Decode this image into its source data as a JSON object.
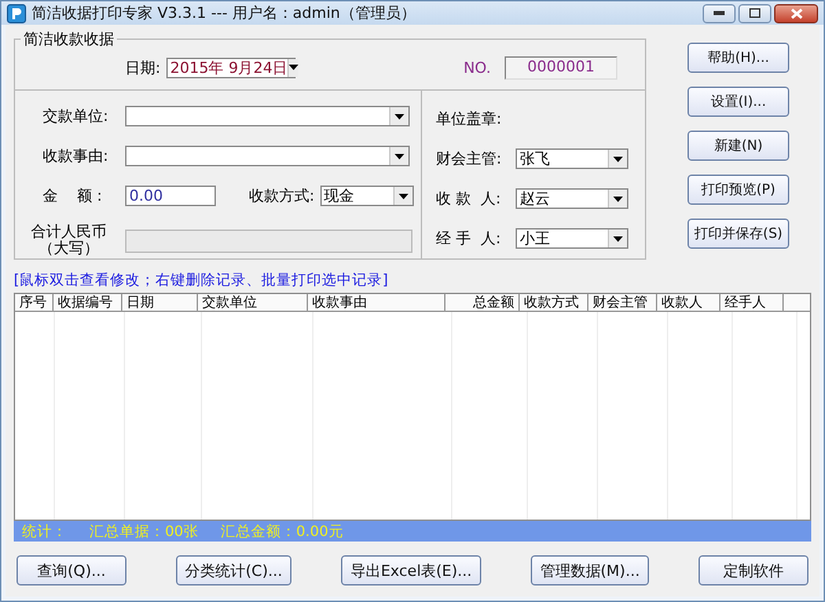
{
  "window": {
    "title": "简洁收据打印专家 V3.3.1 --- 用户名：admin（管理员）"
  },
  "receipt": {
    "title": "简洁收款收据",
    "date_label": "日期:",
    "date_value": "2015年  9月24日",
    "no_label": "NO.",
    "no_value": "0000001",
    "left_fields": [
      {
        "kind": "combo",
        "label": "交款单位:"
      },
      {
        "kind": "combo",
        "label": "收款事由:"
      },
      {
        "kind": "pair",
        "label": "金    额 :",
        "value": "0.00",
        "label2": "收款方式:",
        "value2": "现金"
      },
      {
        "kind": "readonly",
        "label": "合计人民币（大写）"
      }
    ],
    "right_fields": [
      {
        "kind": "label",
        "label": "单位盖章:"
      },
      {
        "kind": "combo",
        "label": "财会主管:",
        "value": "张飞"
      },
      {
        "kind": "combo",
        "label": "收 款  人:",
        "value": "赵云"
      },
      {
        "kind": "combo",
        "label": "经 手  人:",
        "value": "小王"
      }
    ]
  },
  "side_buttons": [
    "帮助(H)...",
    "设置(I)...",
    "新建(N)",
    "打印预览(P)",
    "打印并保存(S)"
  ],
  "hint": "[鼠标双击查看修改；右键删除记录、批量打印选中记录]",
  "table": {
    "columns": [
      {
        "label": "序号",
        "kind": "text"
      },
      {
        "label": "收据编号",
        "kind": "text"
      },
      {
        "label": "日期",
        "kind": "text"
      },
      {
        "label": "交款单位",
        "kind": "text"
      },
      {
        "label": "收款事由",
        "kind": "text"
      },
      {
        "label": "总金额",
        "kind": "number"
      },
      {
        "label": "收款方式",
        "kind": "text"
      },
      {
        "label": "财会主管",
        "kind": "text"
      },
      {
        "label": "收款人",
        "kind": "text"
      },
      {
        "label": "经手人",
        "kind": "text"
      }
    ]
  },
  "stats": [
    "统计：",
    "汇总单据：00张",
    "汇总金额：0.00元"
  ],
  "bottom_buttons": [
    "查询(Q)...",
    "分类统计(C)...",
    "导出Excel表(E)...",
    "管理数据(M)...",
    "定制软件"
  ]
}
